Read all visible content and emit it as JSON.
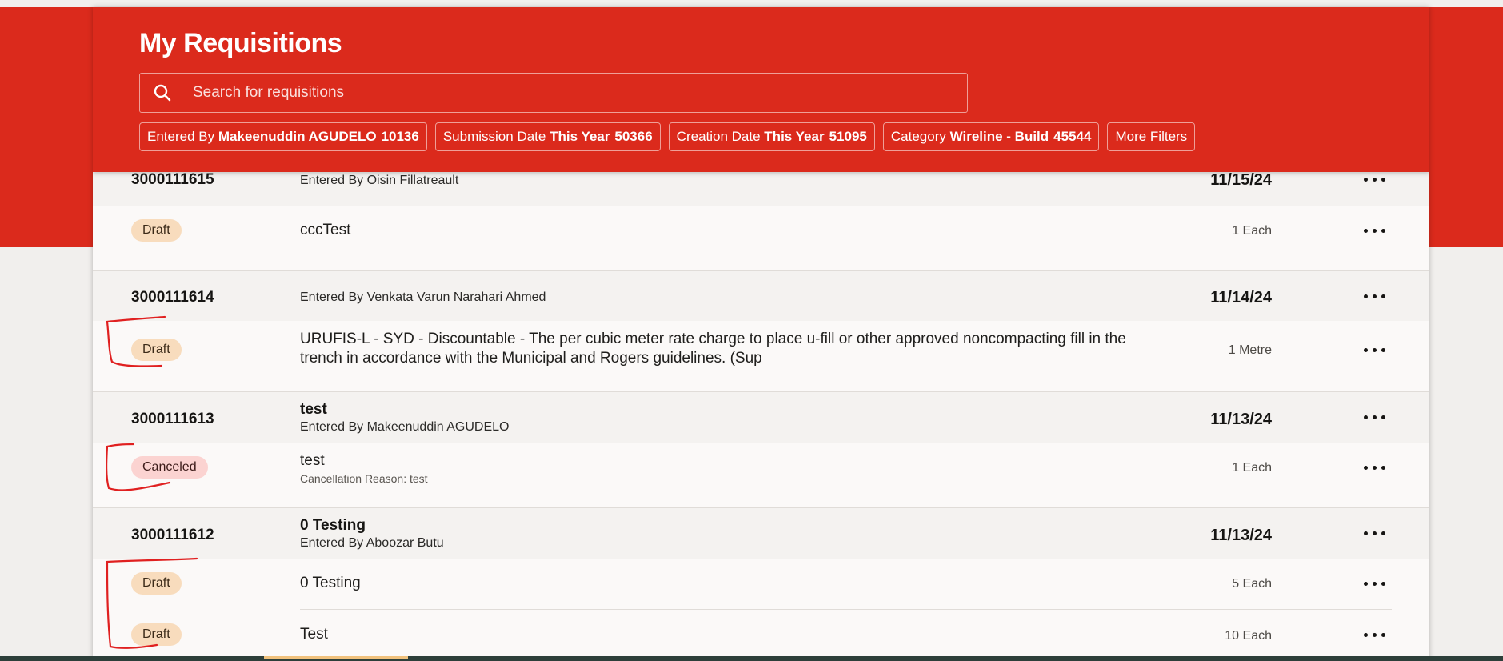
{
  "header": {
    "title": "My Requisitions",
    "search_placeholder": "Search for requisitions",
    "filters": [
      {
        "label": "Entered By",
        "value": "Makeenuddin AGUDELO",
        "count": "10136"
      },
      {
        "label": "Submission Date",
        "value": "This Year",
        "count": "50366"
      },
      {
        "label": "Creation Date",
        "value": "This Year",
        "count": "51095"
      },
      {
        "label": "Category",
        "value": "Wireline - Build",
        "count": "45544"
      }
    ],
    "more_filters": "More Filters"
  },
  "requisitions": [
    {
      "number": "3000111615",
      "entered_by": "Entered By Oisin Fillatreault",
      "date": "11/15/24",
      "lines": [
        {
          "status": "Draft",
          "description": "cccTest",
          "quantity": "1 Each"
        }
      ]
    },
    {
      "number": "3000111614",
      "entered_by": "Entered By Venkata Varun Narahari Ahmed",
      "date": "11/14/24",
      "lines": [
        {
          "status": "Draft",
          "description": "URUFIS-L - SYD - Discountable - The per cubic meter rate charge to place u-fill or other approved noncompacting fill in the trench in accordance with the Municipal and Rogers guidelines. (Sup",
          "quantity": "1 Metre"
        }
      ]
    },
    {
      "number": "3000111613",
      "title": "test",
      "entered_by": "Entered By Makeenuddin AGUDELO",
      "date": "11/13/24",
      "lines": [
        {
          "status": "Canceled",
          "description": "test",
          "note": "Cancellation Reason: test",
          "quantity": "1 Each"
        }
      ]
    },
    {
      "number": "3000111612",
      "title": "0 Testing",
      "entered_by": "Entered By Aboozar Butu",
      "date": "11/13/24",
      "lines": [
        {
          "status": "Draft",
          "description": "0 Testing",
          "quantity": "5 Each"
        },
        {
          "status": "Draft",
          "description": "Test",
          "quantity": "10 Each"
        }
      ]
    }
  ],
  "colors": {
    "brand_red": "#db2a1c",
    "draft_badge": "#f8dcbd",
    "canceled_badge": "#fbd3d1",
    "annotation_red": "#e02020"
  },
  "icons": {
    "search": "search-icon",
    "row_actions": "more-horizontal-icon"
  }
}
